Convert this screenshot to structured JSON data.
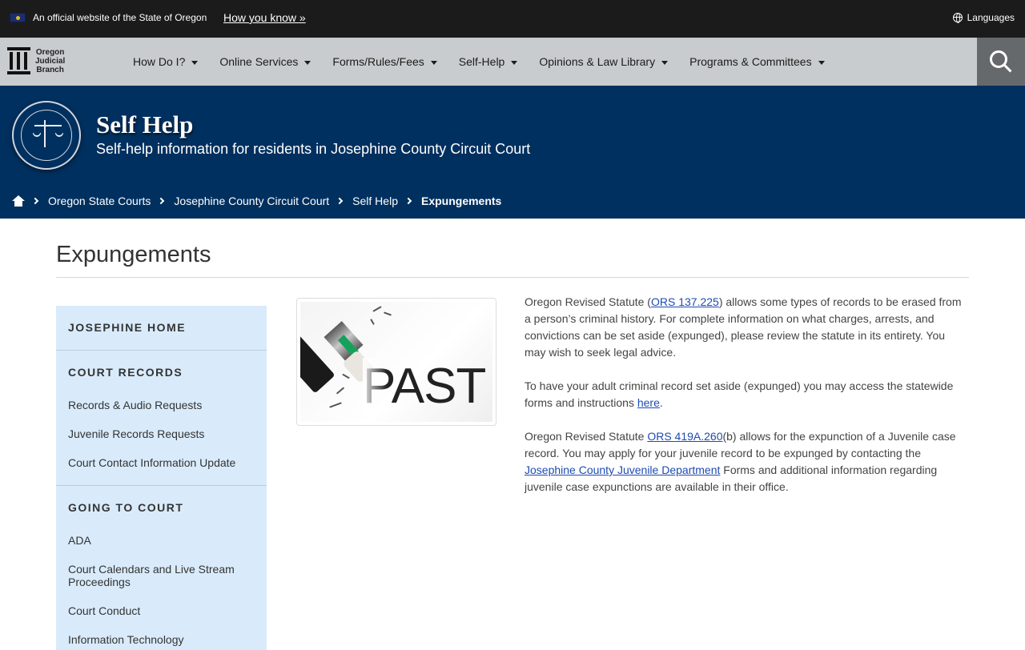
{
  "official_bar": {
    "text": "An official website of the State of Oregon",
    "how_you_know": "How you know »",
    "languages": "Languages"
  },
  "logo": {
    "line1": "Oregon",
    "line2": "Judicial",
    "line3": "Branch"
  },
  "nav": {
    "items": [
      {
        "label": "How Do I?"
      },
      {
        "label": "Online Services"
      },
      {
        "label": "Forms/Rules/Fees"
      },
      {
        "label": "Self-Help"
      },
      {
        "label": "Opinions & Law Library"
      },
      {
        "label": "Programs & Committees"
      }
    ]
  },
  "banner": {
    "title": "Self Help",
    "subtitle": "Self-help information for residents in Josephine County Circuit Court"
  },
  "breadcrumb": {
    "items": [
      "Oregon State Courts",
      "Josephine County Circuit Court",
      "Self Help"
    ],
    "current": "Expungements"
  },
  "page": {
    "title": "Expungements"
  },
  "sidebar": {
    "home": "JOSEPHINE HOME",
    "court_records": {
      "heading": "COURT RECORDS",
      "links": [
        "Records & Audio Requests",
        "Juvenile Records Requests",
        "Court Contact Information Update"
      ]
    },
    "going_to_court": {
      "heading": "GOING TO COURT",
      "links": [
        "ADA",
        "Court Calendars and Live Stream Proceedings",
        "Court Conduct",
        "Information Technology"
      ]
    }
  },
  "image": {
    "text": "PAST"
  },
  "content": {
    "p1_before": "Oregon Revised Statute (",
    "p1_link": "ORS 137.225",
    "p1_after": ") allows some types of records to be erased from a person’s criminal history. For complete information on what charges, arrests, and convictions can be set aside (expunged), please review the statute in its entirety. You may wish to seek legal advice.",
    "p2_before": "To have your adult criminal record set aside (expunged) you may access the statewide forms and instructions ",
    "p2_link": "here",
    "p2_after": ".",
    "p3_before": "Oregon Revised Statute ",
    "p3_link": "ORS 419A.260",
    "p3_middle": "(b) allows for the expunction of a Juvenile case record. You may apply for your juvenile record to be expunged by contacting the ",
    "p3_link2": "Josephine County Juvenile Department",
    "p3_after": " Forms and additional information regarding juvenile case expunctions are available in their office."
  },
  "colors": {
    "official_bar": "#1b1b1b",
    "nav_bg": "#c9ccce",
    "search_bg": "#66696c",
    "banner_bg": "#00305f",
    "sidebar_bg": "#d9ebfb",
    "link": "#1d4bb3"
  }
}
